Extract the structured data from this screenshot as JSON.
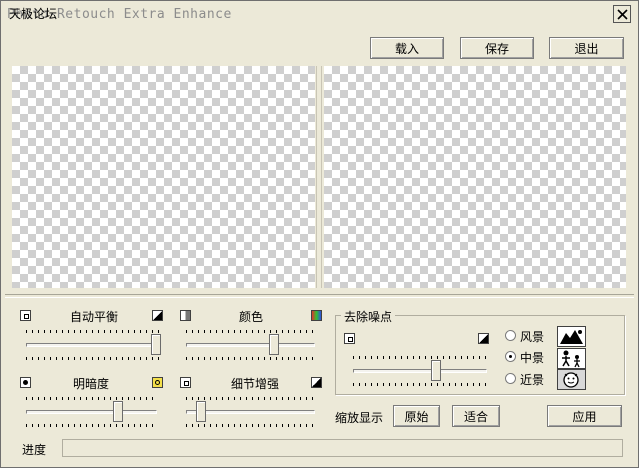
{
  "title": {
    "main": "Photo-Retouch Extra Enhance",
    "overlay": "天极论坛"
  },
  "toolbar": {
    "load_label": "载入",
    "save_label": "保存",
    "exit_label": "退出"
  },
  "controls": {
    "auto_balance": {
      "label": "自动平衡",
      "value": 0.98
    },
    "color": {
      "label": "颜色",
      "value": 0.68
    },
    "brightness": {
      "label": "明暗度",
      "value": 0.7
    },
    "detail": {
      "label": "细节增强",
      "value": 0.12
    }
  },
  "denoise": {
    "label": "去除噪点",
    "value": 0.62,
    "options": [
      "风景",
      "中景",
      "近景"
    ],
    "selected": "中景"
  },
  "zoom": {
    "label": "缩放显示",
    "original_label": "原始",
    "fit_label": "适合"
  },
  "apply_label": "应用",
  "progress": {
    "label": "进度",
    "value": 0
  },
  "colors": {
    "window": "#ece9d8",
    "checker": "#cfcfcf"
  }
}
